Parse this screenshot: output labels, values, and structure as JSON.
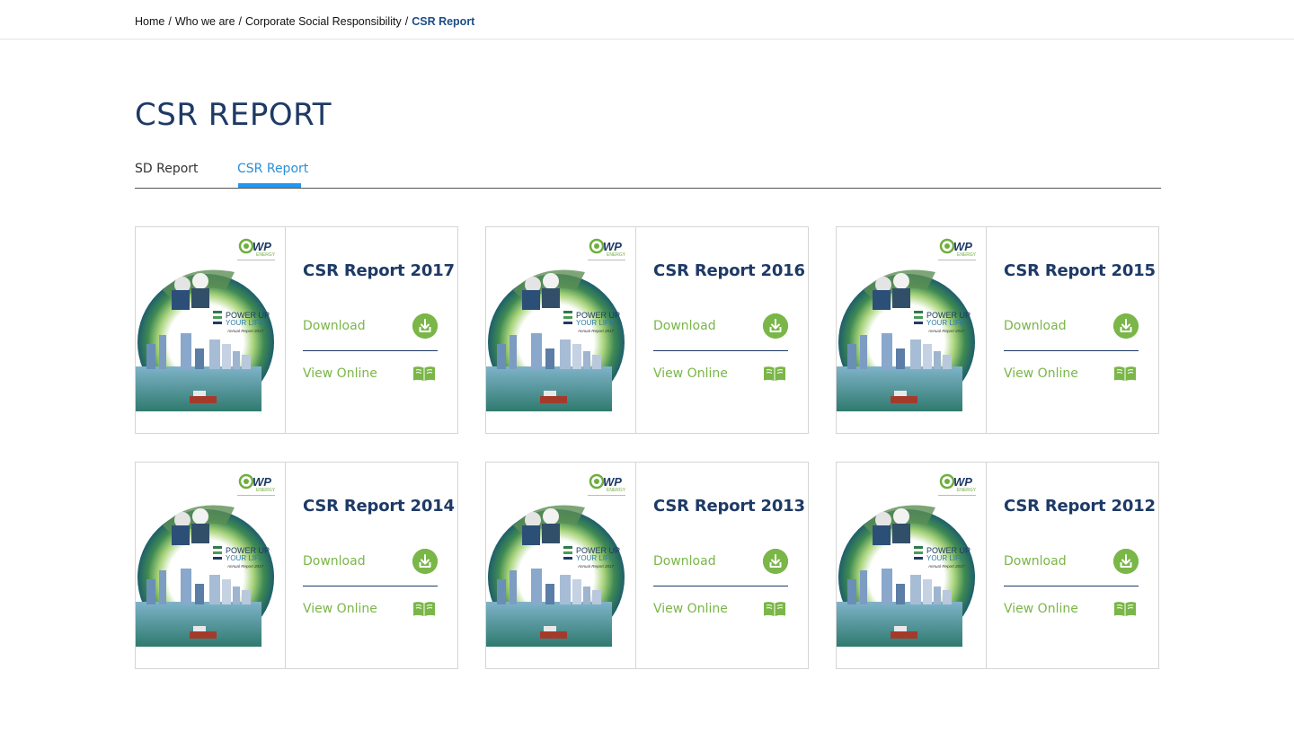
{
  "breadcrumb": {
    "items": [
      "Home",
      "Who we are",
      "Corporate Social Responsibility"
    ],
    "current": "CSR Report",
    "separator": "/"
  },
  "page": {
    "title": "CSR REPORT"
  },
  "tabs": [
    {
      "label": "SD Report",
      "active": false
    },
    {
      "label": "CSR Report",
      "active": true
    }
  ],
  "cover": {
    "brand": "WP",
    "brand_sub": "ENERGY",
    "headline1": "POWER UP",
    "headline2": "YOUR LIFE",
    "subline": "Annual Report 2017"
  },
  "cards": [
    {
      "title": "CSR Report 2017",
      "download": "Download",
      "view": "View Online"
    },
    {
      "title": "CSR Report 2016",
      "download": "Download",
      "view": "View Online"
    },
    {
      "title": "CSR Report 2015",
      "download": "Download",
      "view": "View Online"
    },
    {
      "title": "CSR Report 2014",
      "download": "Download",
      "view": "View Online"
    },
    {
      "title": "CSR Report 2013",
      "download": "Download",
      "view": "View Online"
    },
    {
      "title": "CSR Report 2012",
      "download": "Download",
      "view": "View Online"
    }
  ],
  "colors": {
    "navy": "#1e3a66",
    "green": "#7ab648",
    "tab_active": "#2196f3"
  }
}
